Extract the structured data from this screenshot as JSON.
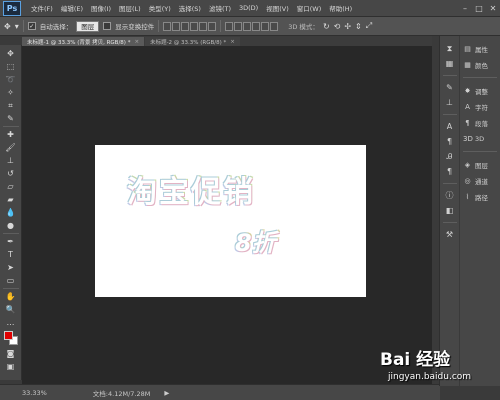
{
  "app": {
    "logo": "Ps"
  },
  "menu": [
    "文件(F)",
    "编辑(E)",
    "图像(I)",
    "图层(L)",
    "类型(Y)",
    "选择(S)",
    "滤镜(T)",
    "3D(D)",
    "视图(V)",
    "窗口(W)",
    "帮助(H)"
  ],
  "window_controls": {
    "minimize": "–",
    "maximize": "□",
    "close": "✕"
  },
  "options": {
    "auto_select_label": "自动选择：",
    "auto_select_checked": "✓",
    "auto_select_value": "图层",
    "show_transform_label": "显示变换控件",
    "mode_3d_label": "3D 模式："
  },
  "tabs": [
    {
      "label": "未标题-1 @ 33.3% (背景 拷贝, RGB/8) *",
      "close": "×"
    },
    {
      "label": "未标题-2 @ 33.3% (RGB/8) *",
      "close": "×"
    }
  ],
  "canvas": {
    "headline": "淘宝促销",
    "discount": "8折",
    "background": "#ffffff"
  },
  "colors": {
    "foreground": "#e00000",
    "background": "#ffffff"
  },
  "status": {
    "zoom": "33.33%",
    "doc_info": "文档:4.12M/7.28M",
    "arrow": "▶"
  },
  "panels": [
    {
      "icon": "▤",
      "label": "属性"
    },
    {
      "icon": "▦",
      "label": "颜色"
    },
    {
      "icon": "✸",
      "label": "调整"
    },
    {
      "icon": "A",
      "label": "字符"
    },
    {
      "icon": "¶",
      "label": "段落"
    },
    {
      "icon": "3D",
      "label": "3D"
    },
    {
      "icon": "◈",
      "label": "图层"
    },
    {
      "icon": "◎",
      "label": "通道"
    },
    {
      "icon": "⌇",
      "label": "路径"
    }
  ],
  "watermark": {
    "logo": "Bai 经验",
    "paw": "🐾",
    "url": "jingyan.baidu.com"
  }
}
